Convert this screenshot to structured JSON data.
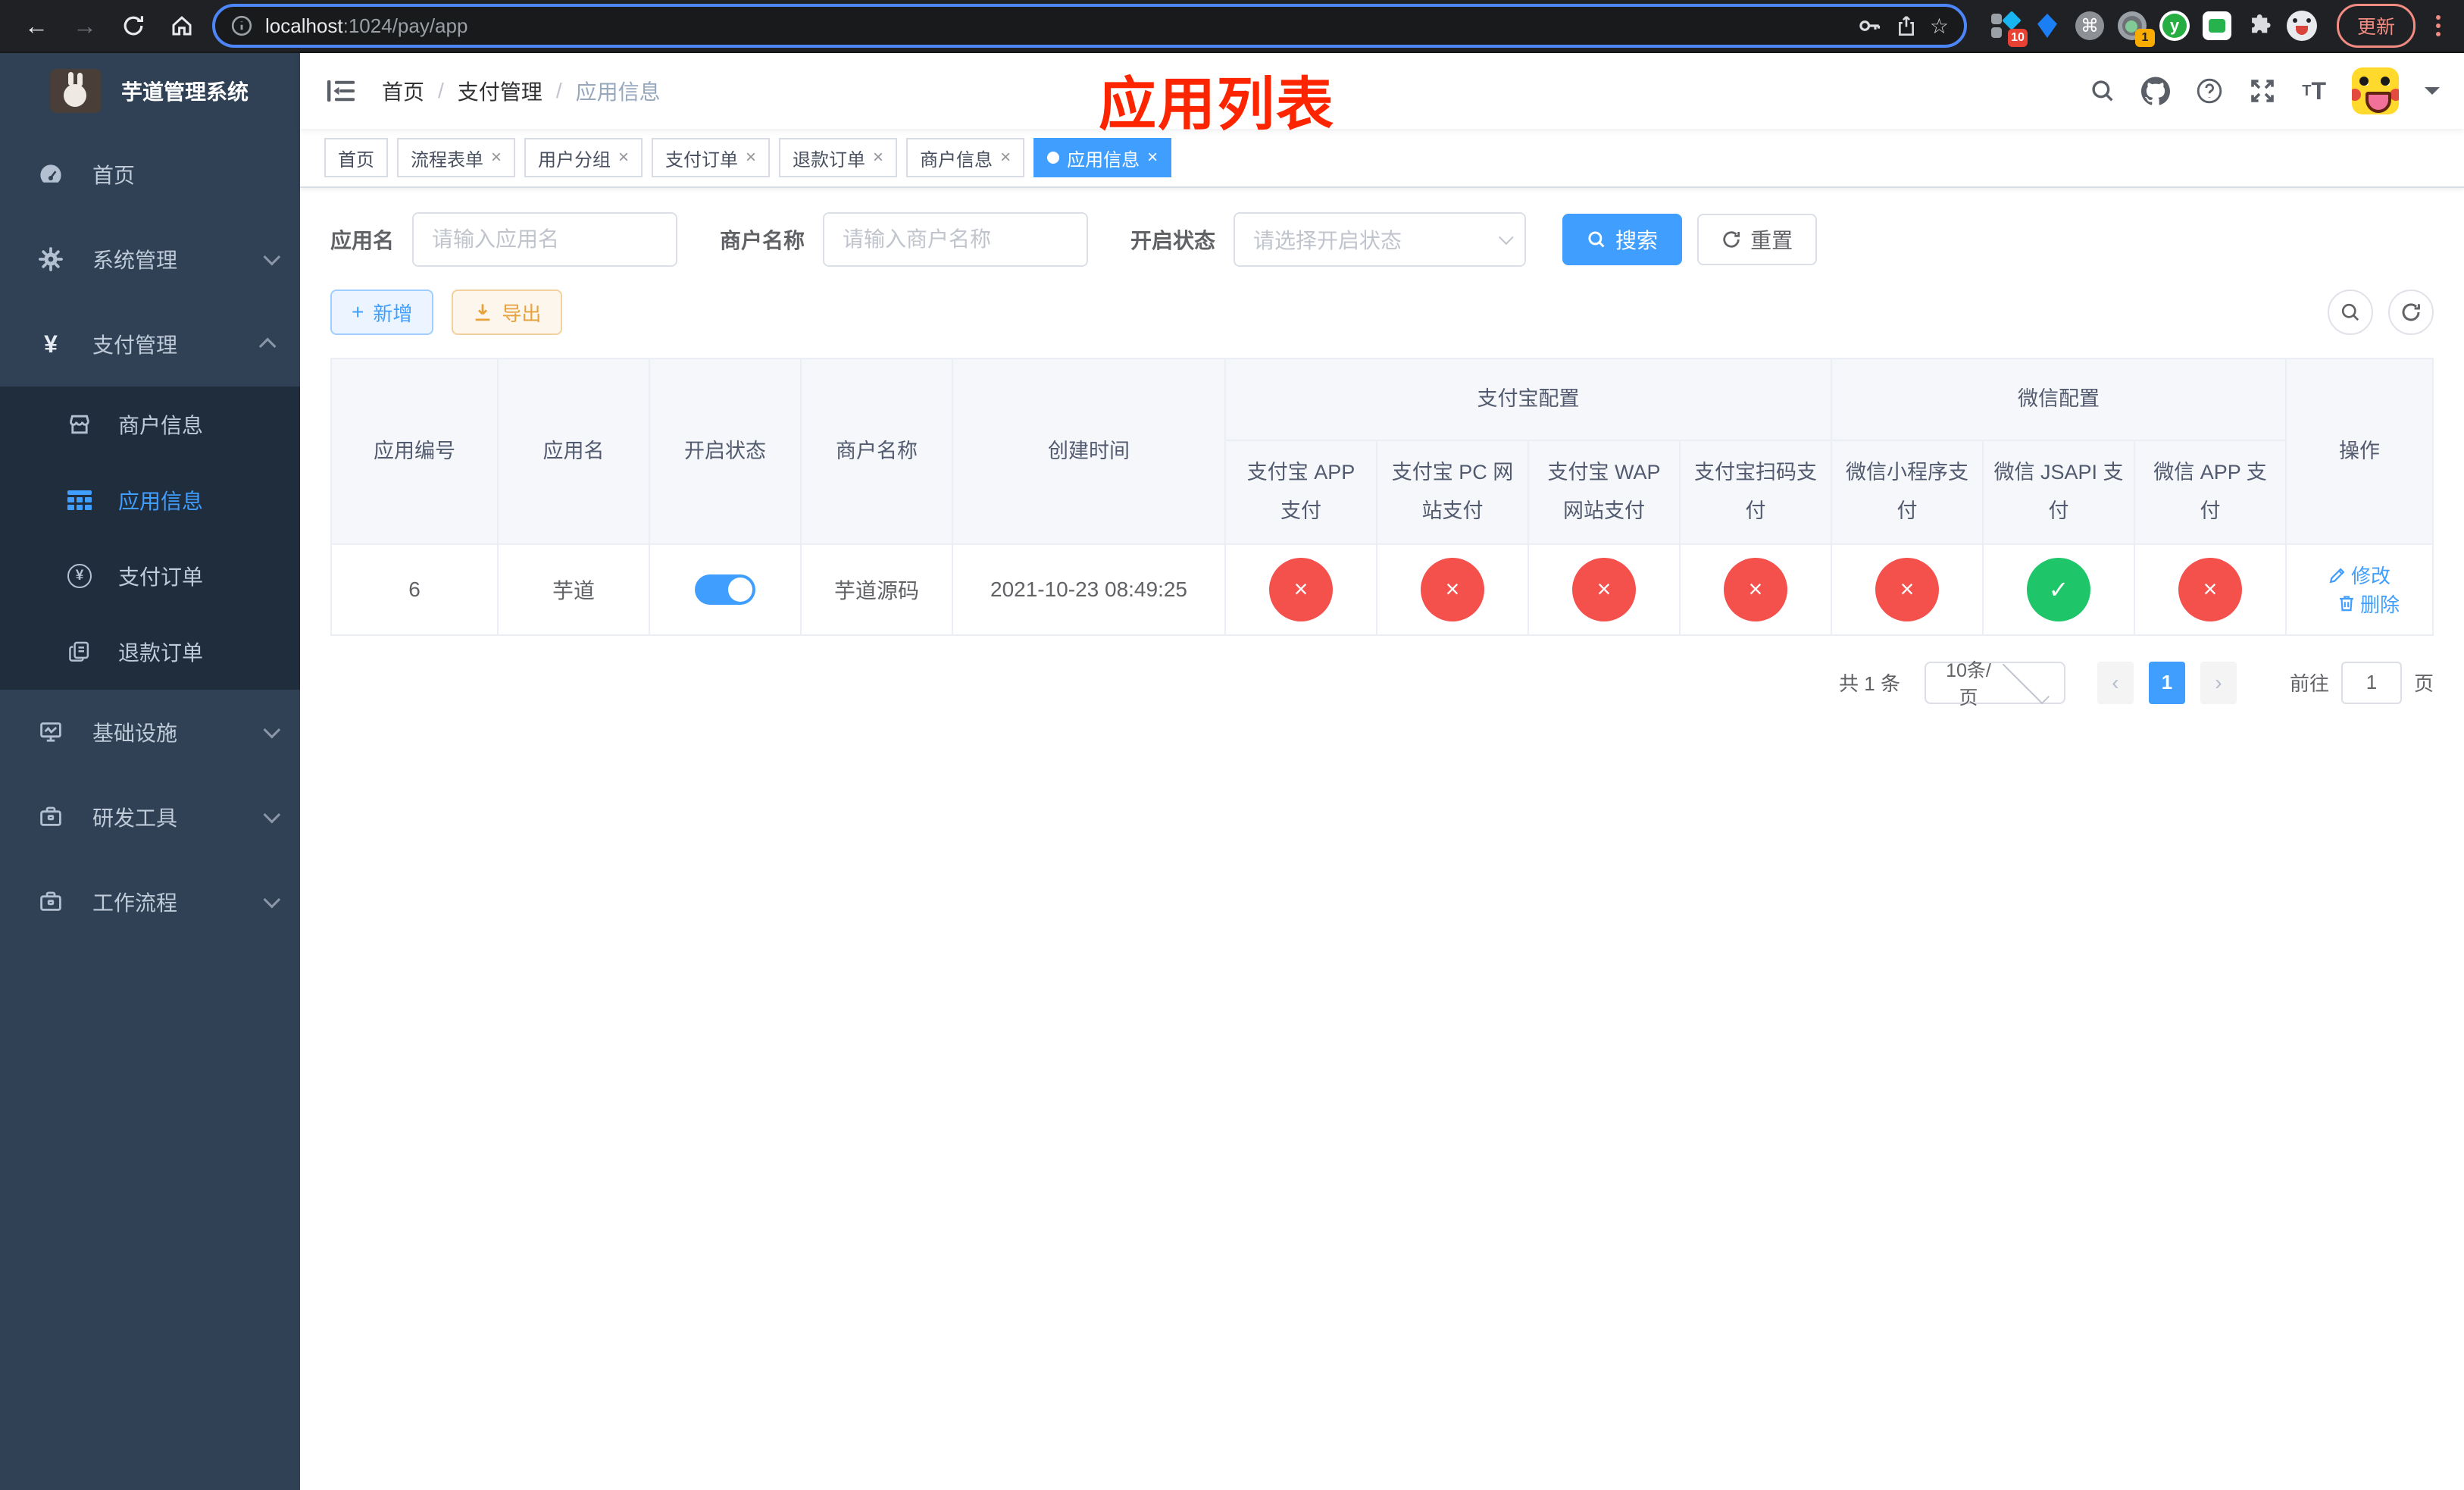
{
  "browser": {
    "url_host": "localhost",
    "url_rest": ":1024/pay/app",
    "update_label": "更新",
    "ext_badge_pin": "10",
    "ext_badge_rec": "1",
    "ext_y_letter": "y"
  },
  "icons": {
    "back": "←",
    "forward": "→",
    "star": "☆",
    "command": "⌘",
    "close": "×",
    "cross": "×",
    "check": "✓",
    "prev": "‹",
    "next": "›",
    "plus": "+",
    "t_small": "T",
    "t_big": "T"
  },
  "sidebar": {
    "title": "芋道管理系统",
    "items": [
      {
        "label": "首页"
      },
      {
        "label": "系统管理"
      },
      {
        "label": "支付管理",
        "children": [
          {
            "label": "商户信息"
          },
          {
            "label": "应用信息",
            "active": true
          },
          {
            "label": "支付订单"
          },
          {
            "label": "退款订单"
          }
        ]
      },
      {
        "label": "基础设施"
      },
      {
        "label": "研发工具"
      },
      {
        "label": "工作流程"
      }
    ]
  },
  "breadcrumb": {
    "items": [
      "首页",
      "支付管理",
      "应用信息"
    ],
    "separator": "/"
  },
  "annotation": "应用列表",
  "tabs": [
    {
      "label": "首页",
      "closable": false,
      "active": false
    },
    {
      "label": "流程表单",
      "closable": true,
      "active": false
    },
    {
      "label": "用户分组",
      "closable": true,
      "active": false
    },
    {
      "label": "支付订单",
      "closable": true,
      "active": false
    },
    {
      "label": "退款订单",
      "closable": true,
      "active": false
    },
    {
      "label": "商户信息",
      "closable": true,
      "active": false
    },
    {
      "label": "应用信息",
      "closable": true,
      "active": true
    }
  ],
  "filters": {
    "app_name_label": "应用名",
    "app_name_placeholder": "请输入应用名",
    "merchant_label": "商户名称",
    "merchant_placeholder": "请输入商户名称",
    "status_label": "开启状态",
    "status_placeholder": "请选择开启状态",
    "search_label": "搜索",
    "reset_label": "重置"
  },
  "toolbar": {
    "add_label": "新增",
    "export_label": "导出"
  },
  "table": {
    "columns": [
      "应用编号",
      "应用名",
      "开启状态",
      "商户名称",
      "创建时间"
    ],
    "groups": [
      {
        "label": "支付宝配置",
        "children": [
          "支付宝 APP 支付",
          "支付宝 PC 网站支付",
          "支付宝 WAP 网站支付",
          "支付宝扫码支付"
        ]
      },
      {
        "label": "微信配置",
        "children": [
          "微信小程序支付",
          "微信 JSAPI 支付",
          "微信 APP 支付"
        ]
      }
    ],
    "actions_column": "操作",
    "rows": [
      {
        "app_id": "6",
        "app_name": "芋道",
        "enabled": true,
        "merchant_name": "芋道源码",
        "create_time": "2021-10-23 08:49:25",
        "statuses": [
          "closed",
          "closed",
          "closed",
          "closed",
          "closed",
          "open",
          "closed"
        ],
        "edit_label": "修改",
        "delete_label": "删除"
      }
    ]
  },
  "pagination": {
    "total_text": "共 1 条",
    "page_size": "10条/页",
    "current_page": "1",
    "goto_label": "前往",
    "goto_value": "1",
    "page_unit": "页"
  },
  "colors": {
    "primary": "#409eff",
    "danger": "#f4504c",
    "success": "#1ec669",
    "sidebar_bg": "#304156",
    "submenu_bg": "#1f2d3d",
    "annotation_red": "#fd2400"
  }
}
